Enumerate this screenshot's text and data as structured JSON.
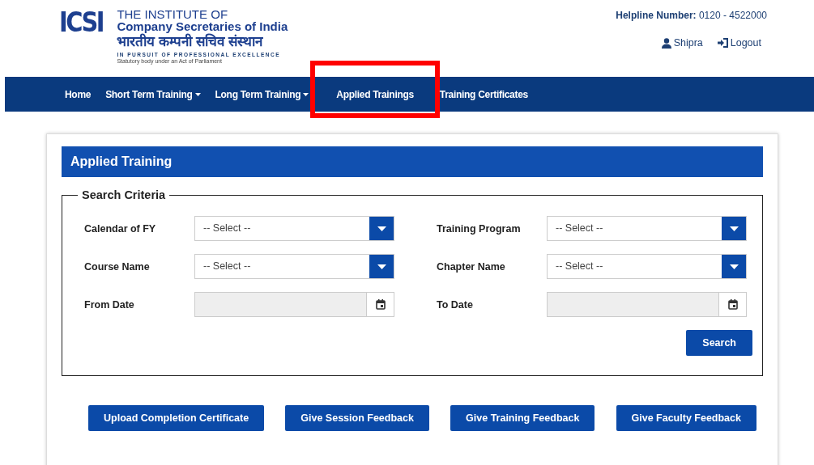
{
  "header": {
    "logo_mark": "ICSI",
    "title_line_1": "THE INSTITUTE OF",
    "title_line_2": "Company Secretaries of India",
    "hindi_name": "भारतीय कम्पनी सचिव संस्थान",
    "tagline": "IN PURSUIT OF PROFESSIONAL EXCELLENCE",
    "statutory_note": "Statutory body under an Act of Parliament",
    "helpline_label": "Helpline Number:",
    "helpline_number": "0120 - 4522000",
    "user_name": "Shipra",
    "logout": "Logout"
  },
  "nav": [
    {
      "label": "Home",
      "dropdown": false,
      "highlighted": false
    },
    {
      "label": "Short Term Training",
      "dropdown": true,
      "highlighted": false
    },
    {
      "label": "Long Term Training",
      "dropdown": true,
      "highlighted": false
    },
    {
      "label": "Applied Trainings",
      "dropdown": false,
      "highlighted": true
    },
    {
      "label": "Training Certificates",
      "dropdown": false,
      "highlighted": false
    }
  ],
  "panel": {
    "title": "Applied Training",
    "legend": "Search Criteria",
    "fields": [
      {
        "label": "Calendar of FY",
        "kind": "select",
        "value": "-- Select --"
      },
      {
        "label": "Training Program",
        "kind": "select",
        "value": "-- Select --"
      },
      {
        "label": "Course Name",
        "kind": "select",
        "value": "-- Select --"
      },
      {
        "label": "Chapter Name",
        "kind": "select",
        "value": "-- Select --"
      },
      {
        "label": "From Date",
        "kind": "date"
      },
      {
        "label": "To Date",
        "kind": "date"
      }
    ],
    "search_button": "Search",
    "actions": [
      "Upload Completion Certificate",
      "Give Session Feedback",
      "Give Training Feedback",
      "Give Faculty Feedback"
    ]
  }
}
